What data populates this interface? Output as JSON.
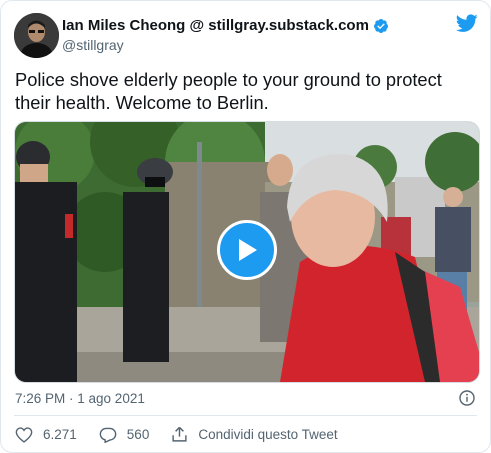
{
  "tweet": {
    "author_name": "Ian Miles Cheong @ stillgray.substack.com",
    "handle": "@stillgray",
    "text": "Police shove elderly people to your ground to protect their health. Welcome to Berlin.",
    "timestamp": "7:26 PM · 1 ago 2021"
  },
  "actions": {
    "likes": "6.271",
    "replies": "560",
    "share_label": "Condividi questo Tweet"
  },
  "icons": {
    "verified": "verified-badge-icon",
    "logo": "twitter-bird-icon",
    "play": "play-icon",
    "info": "info-icon",
    "like": "heart-icon",
    "reply": "reply-icon",
    "share": "share-icon"
  },
  "colors": {
    "accent": "#1d9bf0",
    "text_primary": "#0f1419",
    "text_secondary": "#536471"
  }
}
